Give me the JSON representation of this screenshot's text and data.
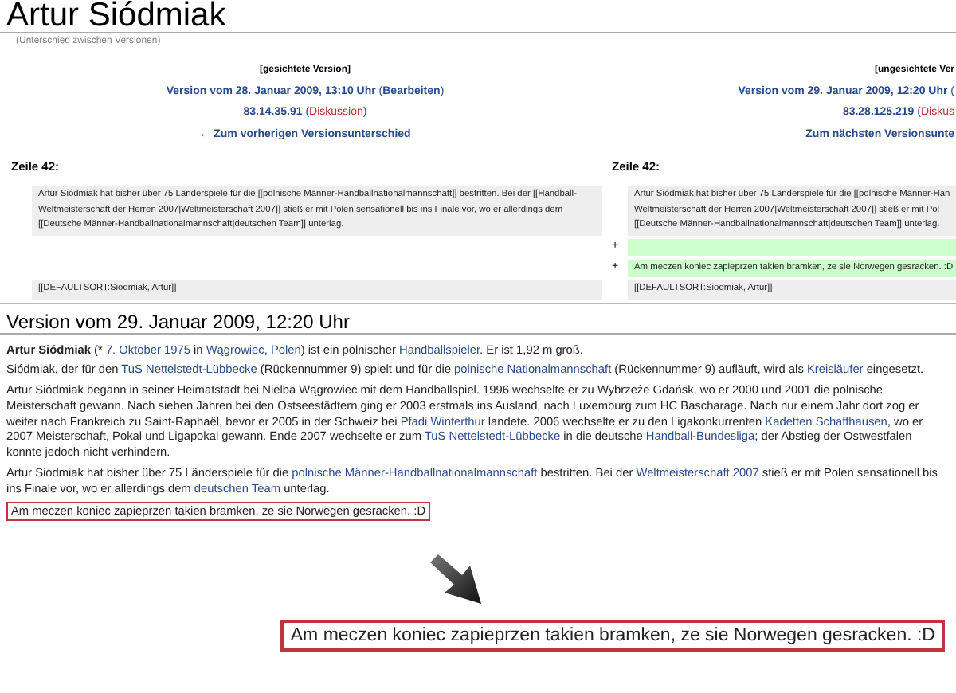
{
  "title": "Artur Siódmiak",
  "subtitle": "(Unterschied zwischen Versionen)",
  "diff": {
    "left_header": [
      [
        {
          "kind": "status",
          "text": "[gesichtete Version]"
        }
      ],
      [
        {
          "kind": "link",
          "text": "Version vom 28. Januar 2009, 13:10 Uhr"
        },
        {
          "kind": "text",
          "text": " ("
        },
        {
          "kind": "link",
          "text": "Bearbeiten"
        },
        {
          "kind": "text",
          "text": ")"
        }
      ],
      [
        {
          "kind": "link",
          "text": "83.14.35.91"
        },
        {
          "kind": "text",
          "text": " ("
        },
        {
          "kind": "redlink",
          "text": "Diskussion"
        },
        {
          "kind": "text",
          "text": ")"
        }
      ],
      [
        {
          "kind": "link",
          "text": "← Zum vorherigen Versionsunterschied"
        }
      ]
    ],
    "right_header": [
      [
        {
          "kind": "status",
          "text": "[ungesichtete Ver"
        }
      ],
      [
        {
          "kind": "link",
          "text": "Version vom 29. Januar 2009, 12:20 Uhr"
        },
        {
          "kind": "text",
          "text": " ("
        }
      ],
      [
        {
          "kind": "link",
          "text": "83.28.125.219"
        },
        {
          "kind": "text",
          "text": " ("
        },
        {
          "kind": "redlink",
          "text": "Diskus"
        }
      ],
      [
        {
          "kind": "link",
          "text": "Zum nächsten Versionsunte"
        }
      ]
    ],
    "left_line_label": "Zeile 42:",
    "right_line_label": "Zeile 42:",
    "rows": [
      {
        "left": {
          "kind": "context",
          "lines": [
            "Artur Siódmiak hat bisher über 75 Länderspiele für die [[polnische Männer-Handballnationalmannschaft]] bestritten. Bei der [[Handball-",
            "Weltmeisterschaft der Herren 2007|Weltmeisterschaft 2007]] stieß er mit Polen sensationell bis ins Finale vor, wo er allerdings dem",
            "[[Deutsche Männer-Handballnationalmannschaft|deutschen Team]] unterlag."
          ]
        },
        "right": {
          "kind": "context",
          "lines": [
            "Artur Siódmiak hat bisher über 75 Länderspiele für die [[polnische Männer-Han",
            "Weltmeisterschaft der Herren 2007|Weltmeisterschaft 2007]] stieß er mit Pol",
            "[[Deutsche Männer-Handballnationalmannschaft|deutschen Team]] unterlag."
          ]
        }
      },
      {
        "right": {
          "kind": "added",
          "marker": "+"
        }
      },
      {
        "right": {
          "kind": "added",
          "marker": "+",
          "lines": [
            "Am meczen koniec zapieprzen takien bramken, ze sie Norwegen gesracken. :D"
          ]
        }
      },
      {
        "left": {
          "kind": "context",
          "lines": [
            "[[DEFAULTSORT:Siodmiak, Artur]]"
          ]
        },
        "right": {
          "kind": "context",
          "lines": [
            "[[DEFAULTSORT:Siodmiak, Artur]]"
          ]
        }
      }
    ]
  },
  "article": {
    "heading": "Version vom 29. Januar 2009, 12:20 Uhr",
    "paragraphs": [
      [
        {
          "kind": "bold",
          "text": "Artur Siódmiak"
        },
        {
          "kind": "text",
          "text": " (* "
        },
        {
          "kind": "link",
          "text": "7. Oktober 1975"
        },
        {
          "kind": "text",
          "text": " in "
        },
        {
          "kind": "link",
          "text": "Wągrowiec, Polen"
        },
        {
          "kind": "text",
          "text": ") ist ein polnischer "
        },
        {
          "kind": "link",
          "text": "Handballspieler"
        },
        {
          "kind": "text",
          "text": ". Er ist 1,92 m groß."
        }
      ],
      [
        {
          "kind": "text",
          "text": "Siódmiak, der für den "
        },
        {
          "kind": "link",
          "text": "TuS Nettelstedt-Lübbecke"
        },
        {
          "kind": "text",
          "text": " (Rückennummer 9) spielt und für die "
        },
        {
          "kind": "link",
          "text": "polnische Nationalmannschaft"
        },
        {
          "kind": "text",
          "text": " (Rückennummer 9) aufläuft, wird als "
        },
        {
          "kind": "link",
          "text": "Kreisläufer"
        },
        {
          "kind": "text",
          "text": " eingesetzt."
        }
      ],
      [
        {
          "kind": "text",
          "text": "Artur Siódmiak begann in seiner Heimatstadt bei Nielba Wągrowiec mit dem Handballspiel. 1996 wechselte er zu Wybrzeże Gdańsk, wo er 2000 und 2001 die polnische Meisterschaft gewann. Nach sieben Jahren bei den Ostseestädtern ging er 2003 erstmals ins Ausland, nach Luxemburg zum HC Bascharage. Nach nur einem Jahr dort zog er weiter nach Frankreich zu Saint-Raphaël, bevor er 2005 in der Schweiz bei "
        },
        {
          "kind": "link",
          "text": "Pfadi Winterthur"
        },
        {
          "kind": "text",
          "text": " landete. 2006 wechselte er zu den Ligakonkurrenten "
        },
        {
          "kind": "link",
          "text": "Kadetten Schaffhausen"
        },
        {
          "kind": "text",
          "text": ", wo er 2007 Meisterschaft, Pokal und Ligapokal gewann. Ende 2007 wechselte er zum "
        },
        {
          "kind": "link",
          "text": "TuS Nettelstedt-Lübbecke"
        },
        {
          "kind": "text",
          "text": " in die deutsche "
        },
        {
          "kind": "link",
          "text": "Handball-Bundesliga"
        },
        {
          "kind": "text",
          "text": "; der Abstieg der Ostwestfalen konnte jedoch nicht verhindern."
        }
      ],
      [
        {
          "kind": "text",
          "text": "Artur Siódmiak hat bisher über 75 Länderspiele für die "
        },
        {
          "kind": "link",
          "text": "polnische Männer-Handballnationalmannschaft"
        },
        {
          "kind": "text",
          "text": " bestritten. Bei der "
        },
        {
          "kind": "link",
          "text": "Weltmeisterschaft 2007"
        },
        {
          "kind": "text",
          "text": " stieß er mit Polen sensationell bis ins Finale vor, wo er allerdings dem "
        },
        {
          "kind": "link",
          "text": "deutschen Team"
        },
        {
          "kind": "text",
          "text": " unterlag."
        }
      ]
    ],
    "highlight": "Am meczen koniec zapieprzen takien bramken, ze sie Norwegen gesracken. :D"
  },
  "callout": {
    "text": "Am meczen koniec zapieprzen takien bramken, ze sie Norwegen gesracken. :D"
  }
}
